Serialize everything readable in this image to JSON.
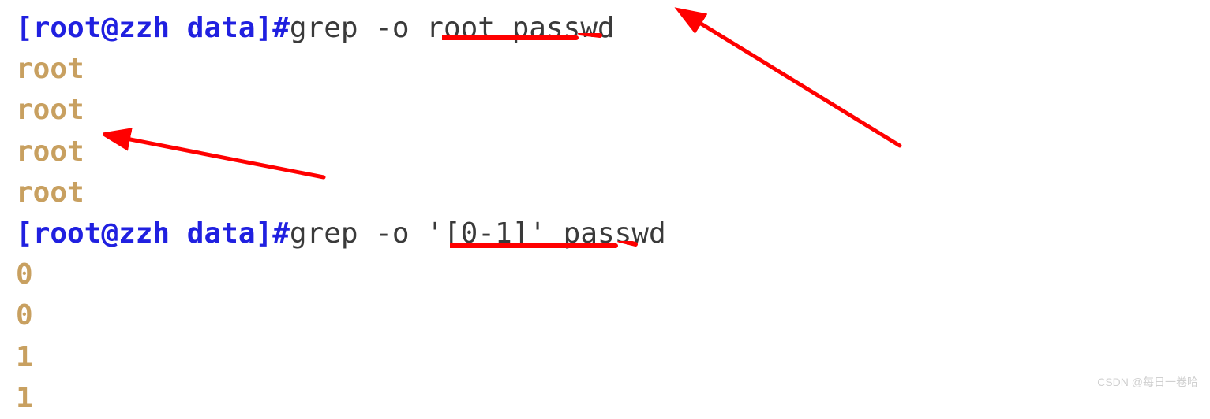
{
  "prompt1": {
    "open": "[",
    "user": "root",
    "at": "@",
    "host": "zzh",
    "space": " ",
    "dir": "data",
    "close": "]",
    "hash": "#"
  },
  "command1": "grep -o root passwd",
  "output1": [
    "root",
    "root",
    "root",
    "root"
  ],
  "prompt2": {
    "open": "[",
    "user": "root",
    "at": "@",
    "host": "zzh",
    "space": " ",
    "dir": "data",
    "close": "]",
    "hash": "#"
  },
  "command2": "grep -o '[0-1]' passwd",
  "output2": [
    "0",
    "0",
    "1",
    "1"
  ],
  "watermark": "CSDN @每日一卷哈"
}
